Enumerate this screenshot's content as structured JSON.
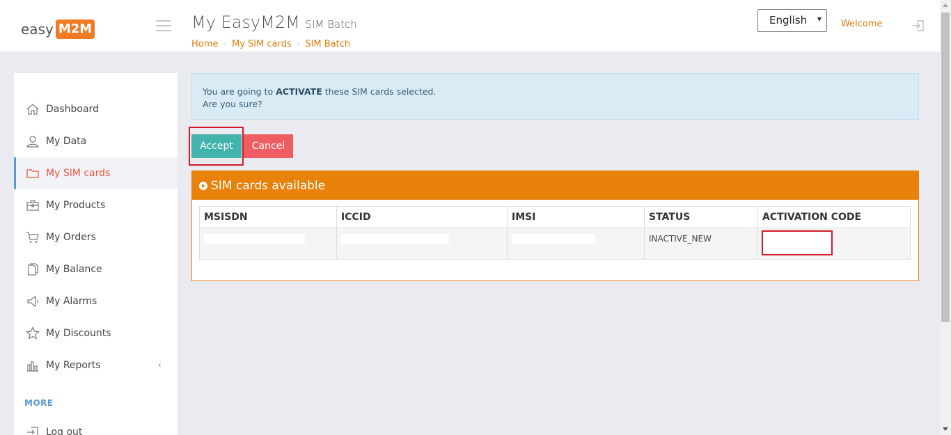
{
  "brand": {
    "logo_left": "easy",
    "logo_right": "M2M"
  },
  "header": {
    "title": "My EasyM2M",
    "subtitle": "SIM Batch",
    "breadcrumb": [
      "Home",
      "My SIM cards",
      "SIM Batch"
    ],
    "language": "English",
    "welcome": "Welcome"
  },
  "sidebar": {
    "items": [
      {
        "label": "Dashboard",
        "icon": "home-icon"
      },
      {
        "label": "My Data",
        "icon": "user-icon"
      },
      {
        "label": "My SIM cards",
        "icon": "folder-icon",
        "active": true
      },
      {
        "label": "My Products",
        "icon": "briefcase-icon"
      },
      {
        "label": "My Orders",
        "icon": "cart-icon"
      },
      {
        "label": "My Balance",
        "icon": "document-icon"
      },
      {
        "label": "My Alarms",
        "icon": "megaphone-icon"
      },
      {
        "label": "My Discounts",
        "icon": "star-icon"
      },
      {
        "label": "My Reports",
        "icon": "bar-chart-icon"
      }
    ],
    "more_label": "MORE",
    "logout": "Log out"
  },
  "alert": {
    "line1_before": "You are going to ",
    "line1_bold": "ACTIVATE",
    "line1_after": " these SIM cards selected.",
    "line2": "Are you sure?"
  },
  "buttons": {
    "accept": "Accept",
    "cancel": "Cancel"
  },
  "panel": {
    "title": "SIM cards available",
    "columns": [
      "MSISDN",
      "ICCID",
      "IMSI",
      "STATUS",
      "ACTIVATION CODE"
    ],
    "rows": [
      {
        "status": "INACTIVE_NEW"
      }
    ]
  },
  "colors": {
    "accent_orange": "#e8820a",
    "accept_teal": "#43b3ad",
    "cancel_red": "#ef5d63",
    "active_nav": "#e8573d"
  }
}
